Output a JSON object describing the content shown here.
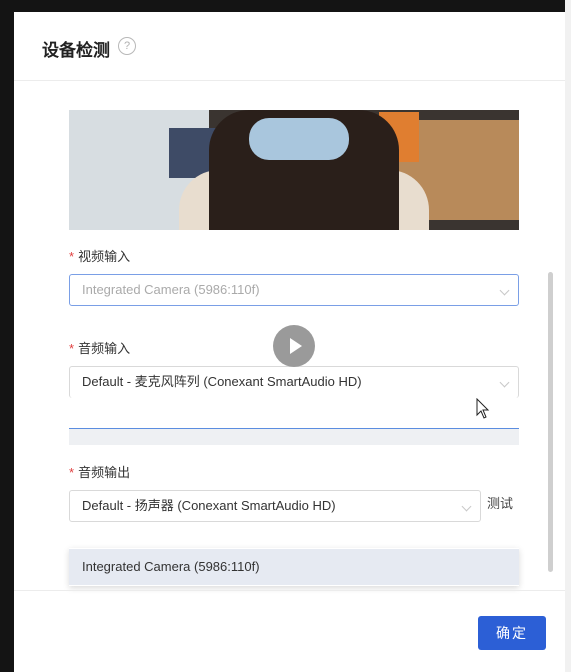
{
  "dialog": {
    "title": "设备检测",
    "help_icon": "?"
  },
  "video_input": {
    "label": "视频输入",
    "required_mark": "*",
    "value": "Integrated Camera (5986:110f)"
  },
  "audio_input": {
    "label": "音频输入",
    "required_mark": "*",
    "value": "Default - 麦克风阵列 (Conexant SmartAudio HD)"
  },
  "audio_output": {
    "label": "音频输出",
    "required_mark": "*",
    "value": "Default - 扬声器 (Conexant SmartAudio HD)",
    "test_label": "测试"
  },
  "dropdown": {
    "options": [
      "Integrated Camera (5986:110f)"
    ]
  },
  "footer": {
    "confirm_label": "确定"
  },
  "colors": {
    "primary": "#2c5fd6",
    "required": "#e04040",
    "level_bar": "#5b8de0"
  }
}
